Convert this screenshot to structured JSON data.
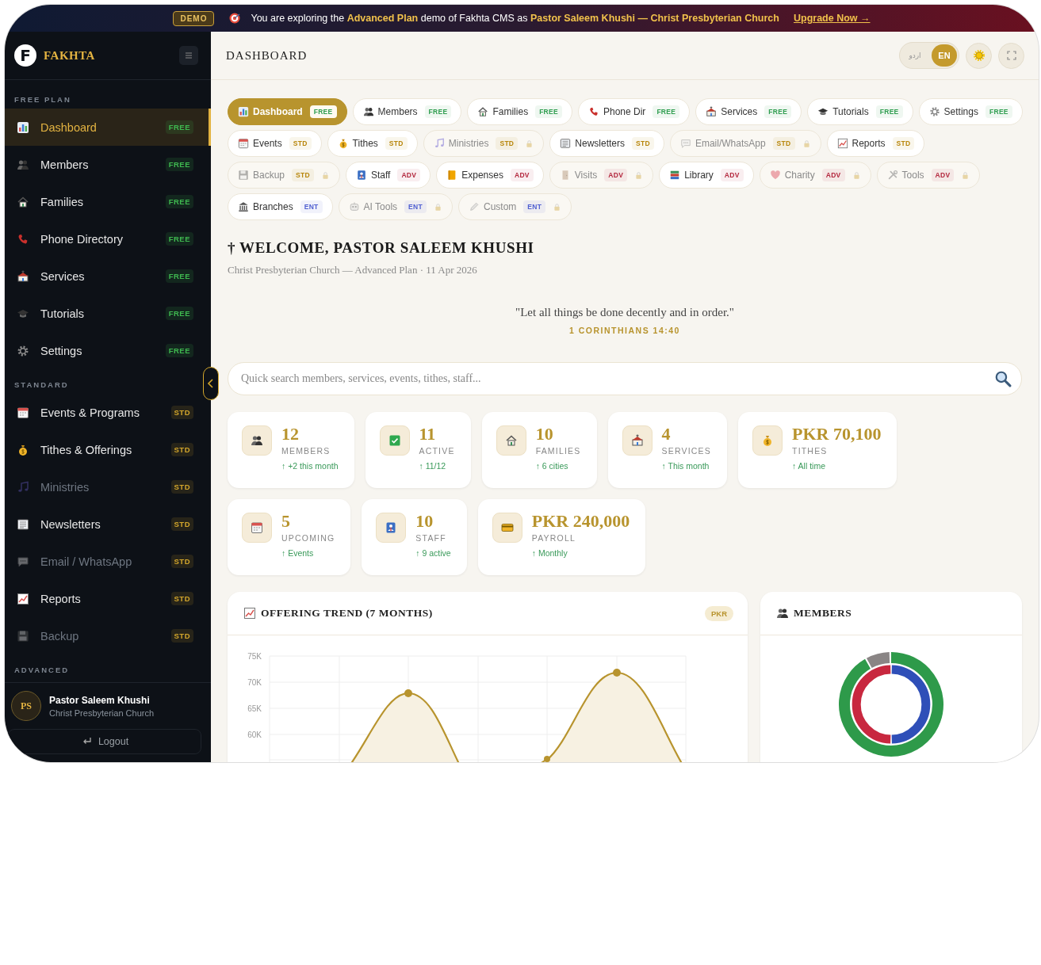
{
  "banner": {
    "badge": "DEMO",
    "message": "You are exploring the **Advanced Plan** demo of Fakhta CMS as **Pastor Saleem Khushi — Christ Presbyterian Church**",
    "link": "Upgrade Now →"
  },
  "sidebar": {
    "logo_mark": "F",
    "brand": "FAKHTA",
    "sections": [
      {
        "label": "FREE PLAN",
        "items": [
          {
            "label": "Dashboard",
            "badge": "FREE",
            "color": "#3fb950",
            "selected": true,
            "disabled": false
          },
          {
            "label": "Members",
            "badge": "FREE",
            "color": "#3fb950",
            "selected": false,
            "disabled": false
          },
          {
            "label": "Families",
            "badge": "FREE",
            "color": "#3fb950",
            "selected": false,
            "disabled": false
          },
          {
            "label": "Phone Directory",
            "badge": "FREE",
            "color": "#3fb950",
            "selected": false,
            "disabled": false
          },
          {
            "label": "Services",
            "badge": "FREE",
            "color": "#3fb950",
            "selected": false,
            "disabled": false
          },
          {
            "label": "Tutorials",
            "badge": "FREE",
            "color": "#3fb950",
            "selected": false,
            "disabled": false
          },
          {
            "label": "Settings",
            "badge": "FREE",
            "color": "#3fb950",
            "selected": false,
            "disabled": false
          }
        ]
      },
      {
        "label": "STANDARD",
        "items": [
          {
            "label": "Events & Programs",
            "badge": "STD",
            "color": "#d4a72c",
            "selected": false,
            "disabled": false
          },
          {
            "label": "Tithes & Offerings",
            "badge": "STD",
            "color": "#d4a72c",
            "selected": false,
            "disabled": false
          },
          {
            "label": "Ministries",
            "badge": "STD",
            "color": "#d4a72c",
            "selected": false,
            "disabled": true
          },
          {
            "label": "Newsletters",
            "badge": "STD",
            "color": "#d4a72c",
            "selected": false,
            "disabled": false
          },
          {
            "label": "Email / WhatsApp",
            "badge": "STD",
            "color": "#d4a72c",
            "selected": false,
            "disabled": true
          },
          {
            "label": "Reports",
            "badge": "STD",
            "color": "#d4a72c",
            "selected": false,
            "disabled": false
          },
          {
            "label": "Backup",
            "badge": "STD",
            "color": "#d4a72c",
            "selected": false,
            "disabled": true
          }
        ]
      },
      {
        "label": "ADVANCED"
      }
    ],
    "user": {
      "initials": "PS",
      "name": "Pastor Saleem Khushi",
      "church": "Christ Presbyterian Church"
    },
    "logout": "Logout"
  },
  "header": {
    "title": "DASHBOARD",
    "languages": [
      {
        "label": "اردو",
        "selected": false
      },
      {
        "label": "EN",
        "selected": true
      }
    ]
  },
  "module_rows": [
    [
      {
        "label": "Dashboard",
        "badge": "FREE",
        "color": "#2f9e50",
        "selected": true,
        "locked": false
      },
      {
        "label": "Members",
        "badge": "FREE",
        "color": "#2f9e50",
        "selected": false,
        "locked": false
      },
      {
        "label": "Families",
        "badge": "FREE",
        "color": "#2f9e50",
        "selected": false,
        "locked": false
      },
      {
        "label": "Phone Dir",
        "badge": "FREE",
        "color": "#2f9e50",
        "selected": false,
        "locked": false
      },
      {
        "label": "Services",
        "badge": "FREE",
        "color": "#2f9e50",
        "selected": false,
        "locked": false
      },
      {
        "label": "Tutorials",
        "badge": "FREE",
        "color": "#2f9e50",
        "selected": false,
        "locked": false
      },
      {
        "label": "Settings",
        "badge": "FREE",
        "color": "#2f9e50",
        "selected": false,
        "locked": false
      }
    ],
    [
      {
        "label": "Events",
        "badge": "STD",
        "color": "#b8860b",
        "selected": false,
        "locked": false
      },
      {
        "label": "Tithes",
        "badge": "STD",
        "color": "#b8860b",
        "selected": false,
        "locked": false
      },
      {
        "label": "Ministries",
        "badge": "STD",
        "color": "#b8860b",
        "selected": false,
        "locked": true
      },
      {
        "label": "Newsletters",
        "badge": "STD",
        "color": "#b8860b",
        "selected": false,
        "locked": false
      },
      {
        "label": "Email/WhatsApp",
        "badge": "STD",
        "color": "#b8860b",
        "selected": false,
        "locked": true
      },
      {
        "label": "Reports",
        "badge": "STD",
        "color": "#b8860b",
        "selected": false,
        "locked": false
      }
    ],
    [
      {
        "label": "Backup",
        "badge": "STD",
        "color": "#b8860b",
        "selected": false,
        "locked": true
      },
      {
        "label": "Staff",
        "badge": "ADV",
        "color": "#b3273d",
        "selected": false,
        "locked": false
      },
      {
        "label": "Expenses",
        "badge": "ADV",
        "color": "#b3273d",
        "selected": false,
        "locked": false
      },
      {
        "label": "Visits",
        "badge": "ADV",
        "color": "#b3273d",
        "selected": false,
        "locked": true
      },
      {
        "label": "Library",
        "badge": "ADV",
        "color": "#b3273d",
        "selected": false,
        "locked": false
      },
      {
        "label": "Charity",
        "badge": "ADV",
        "color": "#b3273d",
        "selected": false,
        "locked": true
      },
      {
        "label": "Tools",
        "badge": "ADV",
        "color": "#b3273d",
        "selected": false,
        "locked": true
      }
    ],
    [
      {
        "label": "Branches",
        "badge": "ENT",
        "color": "#4f5fd1",
        "selected": false,
        "locked": false
      },
      {
        "label": "AI Tools",
        "badge": "ENT",
        "color": "#4f5fd1",
        "selected": false,
        "locked": true
      },
      {
        "label": "Custom",
        "badge": "ENT",
        "color": "#4f5fd1",
        "selected": false,
        "locked": true
      }
    ]
  ],
  "welcome": {
    "title": "† WELCOME, PASTOR SALEEM KHUSHI",
    "subtitle": "Christ Presbyterian Church — Advanced Plan · 11 Apr 2026"
  },
  "verse": {
    "text": "\"Let all things be done decently and in order.\"",
    "reference": "1 CORINTHIANS 14:40"
  },
  "search": {
    "placeholder": "Quick search members, services, events, tithes, staff..."
  },
  "stats_rows": [
    [
      {
        "value": "12",
        "label": "MEMBERS",
        "change": "↑ +2 this month"
      },
      {
        "value": "11",
        "label": "ACTIVE",
        "change": "↑ 11/12"
      },
      {
        "value": "10",
        "label": "FAMILIES",
        "change": "↑ 6 cities"
      },
      {
        "value": "4",
        "label": "SERVICES",
        "change": "↑ This month"
      },
      {
        "value": "PKR 70,100",
        "label": "TITHES",
        "change": "↑ All time"
      }
    ],
    [
      {
        "value": "5",
        "label": "UPCOMING",
        "change": "↑ Events"
      },
      {
        "value": "10",
        "label": "STAFF",
        "change": "↑ 9 active"
      },
      {
        "value": "PKR 240,000",
        "label": "PAYROLL",
        "change": "↑ Monthly"
      }
    ]
  ],
  "offering_panel": {
    "title": "OFFERING TREND (7 MONTHS)",
    "badge": "PKR",
    "y_labels": [
      "75K",
      "70K",
      "65K",
      "60K"
    ]
  },
  "members_panel": {
    "title": "MEMBERS"
  }
}
